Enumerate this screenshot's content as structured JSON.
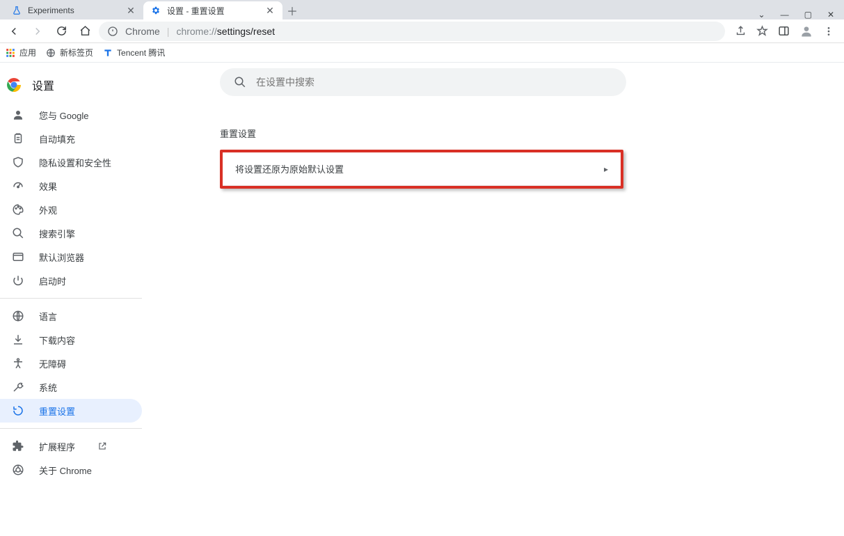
{
  "tabs": [
    {
      "title": "Experiments"
    },
    {
      "title": "设置 - 重置设置"
    }
  ],
  "window_buttons": {
    "chevron": "⌄",
    "min": "—",
    "max": "▢",
    "close": "✕"
  },
  "toolbar": {
    "secure_label": "Chrome",
    "url_prefix": "chrome://",
    "url_path": "settings/reset"
  },
  "bookmarks": [
    {
      "label": "应用",
      "icon": "grid"
    },
    {
      "label": "新标签页",
      "icon": "globe"
    },
    {
      "label": "Tencent 腾讯",
      "icon": "t"
    }
  ],
  "settings": {
    "title": "设置",
    "search_placeholder": "在设置中搜索",
    "section_title": "重置设置",
    "reset_row_label": "将设置还原为原始默认设置"
  },
  "sidebar": {
    "groups": [
      [
        {
          "icon": "person",
          "label": "您与 Google"
        },
        {
          "icon": "clipboard",
          "label": "自动填充"
        },
        {
          "icon": "shield",
          "label": "隐私设置和安全性"
        },
        {
          "icon": "speed",
          "label": "效果"
        },
        {
          "icon": "palette",
          "label": "外观"
        },
        {
          "icon": "search",
          "label": "搜索引擎"
        },
        {
          "icon": "browser",
          "label": "默认浏览器"
        },
        {
          "icon": "power",
          "label": "启动时"
        }
      ],
      [
        {
          "icon": "globe",
          "label": "语言"
        },
        {
          "icon": "download",
          "label": "下载内容"
        },
        {
          "icon": "accessibility",
          "label": "无障碍"
        },
        {
          "icon": "wrench",
          "label": "系统"
        },
        {
          "icon": "reset",
          "label": "重置设置",
          "active": true
        }
      ],
      [
        {
          "icon": "extension",
          "label": "扩展程序",
          "external": true
        },
        {
          "icon": "chrome",
          "label": "关于 Chrome"
        }
      ]
    ]
  }
}
